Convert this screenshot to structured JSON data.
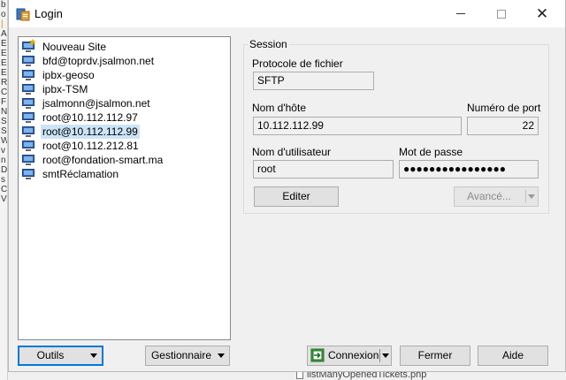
{
  "window": {
    "title": "Login",
    "minimize_label": "",
    "maximize_label": "",
    "close_label": "✕"
  },
  "sites": [
    {
      "label": "Nouveau Site",
      "icon": "new-site-icon",
      "selected": false
    },
    {
      "label": "bfd@toprdv.jsalmon.net",
      "icon": "computer-icon",
      "selected": false
    },
    {
      "label": "ipbx-geoso",
      "icon": "computer-icon",
      "selected": false
    },
    {
      "label": "ipbx-TSM",
      "icon": "computer-icon",
      "selected": false
    },
    {
      "label": "jsalmonn@jsalmon.net",
      "icon": "computer-icon",
      "selected": false
    },
    {
      "label": "root@10.112.112.97",
      "icon": "computer-icon",
      "selected": false
    },
    {
      "label": "root@10.112.112.99",
      "icon": "computer-icon",
      "selected": true
    },
    {
      "label": "root@10.112.212.81",
      "icon": "computer-icon",
      "selected": false
    },
    {
      "label": "root@fondation-smart.ma",
      "icon": "computer-icon",
      "selected": false
    },
    {
      "label": "smtRéclamation",
      "icon": "computer-icon",
      "selected": false
    }
  ],
  "session": {
    "legend": "Session",
    "protocol_label": "Protocole de fichier",
    "protocol_value": "SFTP",
    "host_label": "Nom d'hôte",
    "host_value": "10.112.112.99",
    "port_label": "Numéro de port",
    "port_value": "22",
    "user_label": "Nom d'utilisateur",
    "user_value": "root",
    "password_label": "Mot de passe",
    "password_value": "●●●●●●●●●●●●●●●●",
    "edit_button": "Editer",
    "advanced_button": "Avancé..."
  },
  "footer": {
    "tools_button": "Outils",
    "manager_button": "Gestionnaire",
    "connect_button": "Connexion",
    "close_button": "Fermer",
    "help_button": "Aide"
  },
  "background": {
    "file_name": "listManyOpenedTickets.php"
  },
  "colors": {
    "selection": "#cce4f7",
    "focus_border": "#0078d7",
    "window_bg": "#f0f0f0"
  }
}
